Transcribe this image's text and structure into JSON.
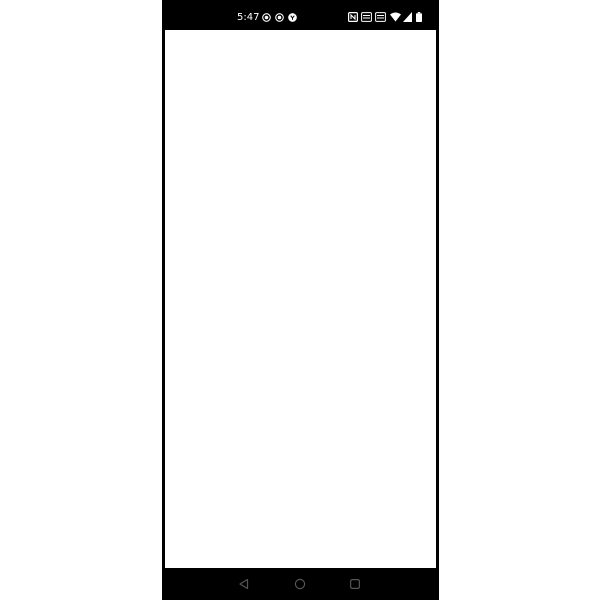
{
  "status_bar": {
    "time": "5:47",
    "notification_icons": [
      "record-icon",
      "record-icon",
      "app-notification-icon"
    ],
    "system_icons": [
      "nfc-icon",
      "volte-icon",
      "volte-icon",
      "wifi-icon",
      "cellular-signal-icon",
      "battery-icon"
    ]
  },
  "screen": {
    "background": "#ffffff"
  },
  "nav_bar": {
    "buttons": [
      "back-icon",
      "home-icon",
      "recents-icon"
    ]
  },
  "colors": {
    "frame": "#000000",
    "screen": "#ffffff",
    "status_foreground": "#ffffff",
    "nav_foreground": "#555555"
  }
}
